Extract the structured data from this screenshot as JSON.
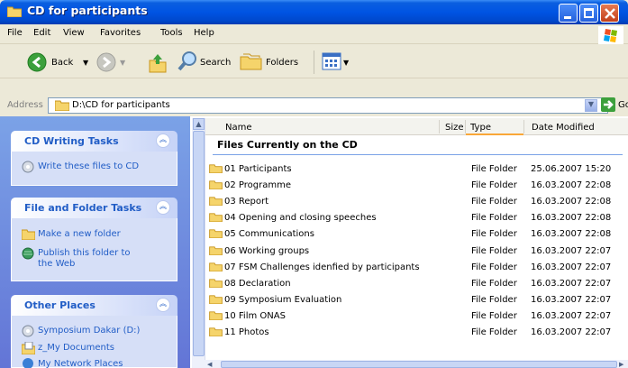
{
  "window": {
    "title": "CD for participants"
  },
  "menu": [
    "File",
    "Edit",
    "View",
    "Favorites",
    "Tools",
    "Help"
  ],
  "toolbar": {
    "back": "Back",
    "search": "Search",
    "folders": "Folders"
  },
  "address": {
    "label": "Address",
    "value": "D:\\CD for participants",
    "go": "Go"
  },
  "sidebar": {
    "cd_tasks": {
      "title": "CD Writing Tasks",
      "items": [
        "Write these files to CD"
      ]
    },
    "folder_tasks": {
      "title": "File and Folder Tasks",
      "items": [
        "Make a new folder",
        "Publish this folder to",
        "the Web"
      ]
    },
    "other_places": {
      "title": "Other Places",
      "items": [
        "Symposium Dakar (D:)",
        "z_My Documents",
        "My Network Places"
      ]
    }
  },
  "columns": [
    "Name",
    "Size",
    "Type",
    "Date Modified"
  ],
  "group_title": "Files Currently on the CD",
  "files": [
    {
      "name": "01 Participants",
      "type": "File Folder",
      "date": "25.06.2007 15:20"
    },
    {
      "name": "02 Programme",
      "type": "File Folder",
      "date": "16.03.2007 22:08"
    },
    {
      "name": "03 Report",
      "type": "File Folder",
      "date": "16.03.2007 22:08"
    },
    {
      "name": "04 Opening and closing speeches",
      "type": "File Folder",
      "date": "16.03.2007 22:08"
    },
    {
      "name": "05 Communications",
      "type": "File Folder",
      "date": "16.03.2007 22:08"
    },
    {
      "name": "06 Working groups",
      "type": "File Folder",
      "date": "16.03.2007 22:07"
    },
    {
      "name": "07 FSM Challenges idenfied  by participants",
      "type": "File Folder",
      "date": "16.03.2007 22:07"
    },
    {
      "name": "08 Declaration",
      "type": "File Folder",
      "date": "16.03.2007 22:07"
    },
    {
      "name": "09 Symposium Evaluation",
      "type": "File Folder",
      "date": "16.03.2007 22:07"
    },
    {
      "name": "10 Film ONAS",
      "type": "File Folder",
      "date": "16.03.2007 22:07"
    },
    {
      "name": "11 Photos",
      "type": "File Folder",
      "date": "16.03.2007 22:07"
    }
  ]
}
